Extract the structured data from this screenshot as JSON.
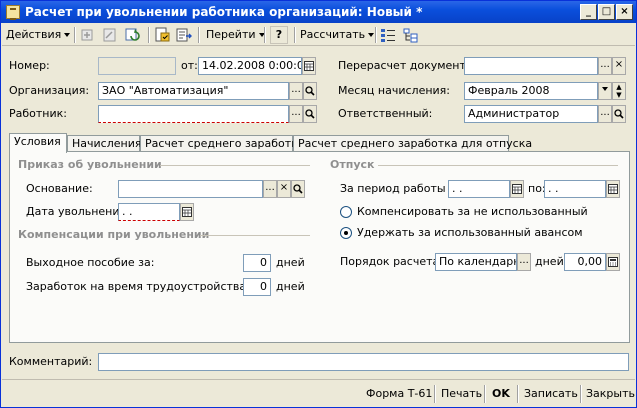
{
  "window": {
    "title": "Расчет при увольнении работника организаций: Новый *",
    "min": "_",
    "max": "□",
    "close": "×"
  },
  "toolbar": {
    "actions": "Действия",
    "goto": "Перейти",
    "help": "?",
    "calculate": "Рассчитать"
  },
  "header": {
    "number_label": "Номер:",
    "number_value": "",
    "date_label": "от:",
    "date_value": "14.02.2008 0:00:00",
    "org_label": "Организация:",
    "org_value": "ЗАО \"Автоматизация\"",
    "worker_label": "Работник:",
    "worker_value": "",
    "recalc_label": "Перерасчет документа:",
    "recalc_value": "",
    "month_label": "Месяц начисления:",
    "month_value": "Февраль 2008",
    "resp_label": "Ответственный:",
    "resp_value": "Администратор"
  },
  "tabs": [
    {
      "label": "Условия"
    },
    {
      "label": "Начисления"
    },
    {
      "label": "Расчет среднего заработка"
    },
    {
      "label": "Расчет среднего заработка для отпуска"
    }
  ],
  "conditions": {
    "order_title": "Приказ об увольнении",
    "basis_label": "Основание:",
    "basis_value": "",
    "dismiss_date_label": "Дата увольнения:",
    "dismiss_date_value": " .  .",
    "comp_title": "Компенсации при увольнении",
    "severance_label": "Выходное пособие за:",
    "severance_value": "0",
    "severance_unit": "дней",
    "job_search_label": "Заработок на время трудоустройства за:",
    "job_search_value": "0",
    "job_search_unit": "дней",
    "vacation_title": "Отпуск",
    "period_label": "За период работы с:",
    "period_from": " .  .",
    "period_to_label": "по:",
    "period_to": " .  .",
    "radio_compensate": "Компенсировать за не использованный",
    "radio_withhold": "Удержать за использованный авансом",
    "order_calc_label": "Порядок расчета:",
    "order_calc_value": "По календарны",
    "days_label": "дней:",
    "days_value": "0,00"
  },
  "comment": {
    "label": "Комментарий:",
    "value": ""
  },
  "statusbar": {
    "form": "Форма Т-61",
    "print": "Печать",
    "ok": "OK",
    "save": "Записать",
    "close": "Закрыть"
  },
  "colors": {
    "titlebar": "#0a4fdc",
    "window_bg": "#ece9d8",
    "panel_bg": "#fbfbf9"
  }
}
